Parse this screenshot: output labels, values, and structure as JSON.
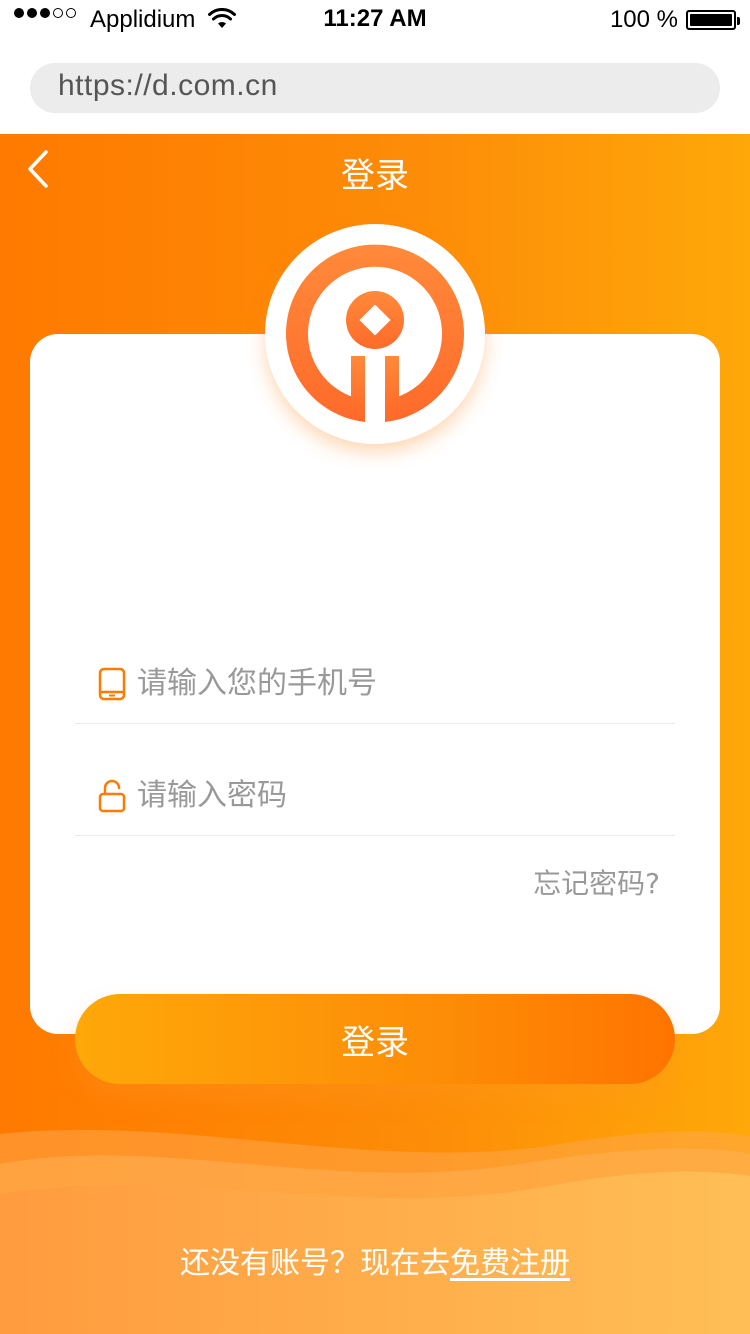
{
  "status_bar": {
    "carrier": "Applidium",
    "time": "11:27 AM",
    "battery": "100 %",
    "signal_bars_filled": 3,
    "signal_bars_total": 5
  },
  "browser": {
    "url": "https://d.com.cn"
  },
  "nav": {
    "title": "登录",
    "back_icon": "chevron-left-icon"
  },
  "logo": {
    "icon": "coin-logo-icon"
  },
  "form": {
    "phone_placeholder": "请输入您的手机号",
    "phone_icon": "phone-icon",
    "password_placeholder": "请输入密码",
    "password_icon": "unlock-icon",
    "forgot_password": "忘记密码?",
    "login_button": "登录"
  },
  "footer": {
    "prompt": "还没有账号？现在去",
    "register_link": "免费注册"
  },
  "colors": {
    "accent": "#ff7a00",
    "accent_light": "#fea809",
    "placeholder": "#999999",
    "divider": "#ececec"
  }
}
